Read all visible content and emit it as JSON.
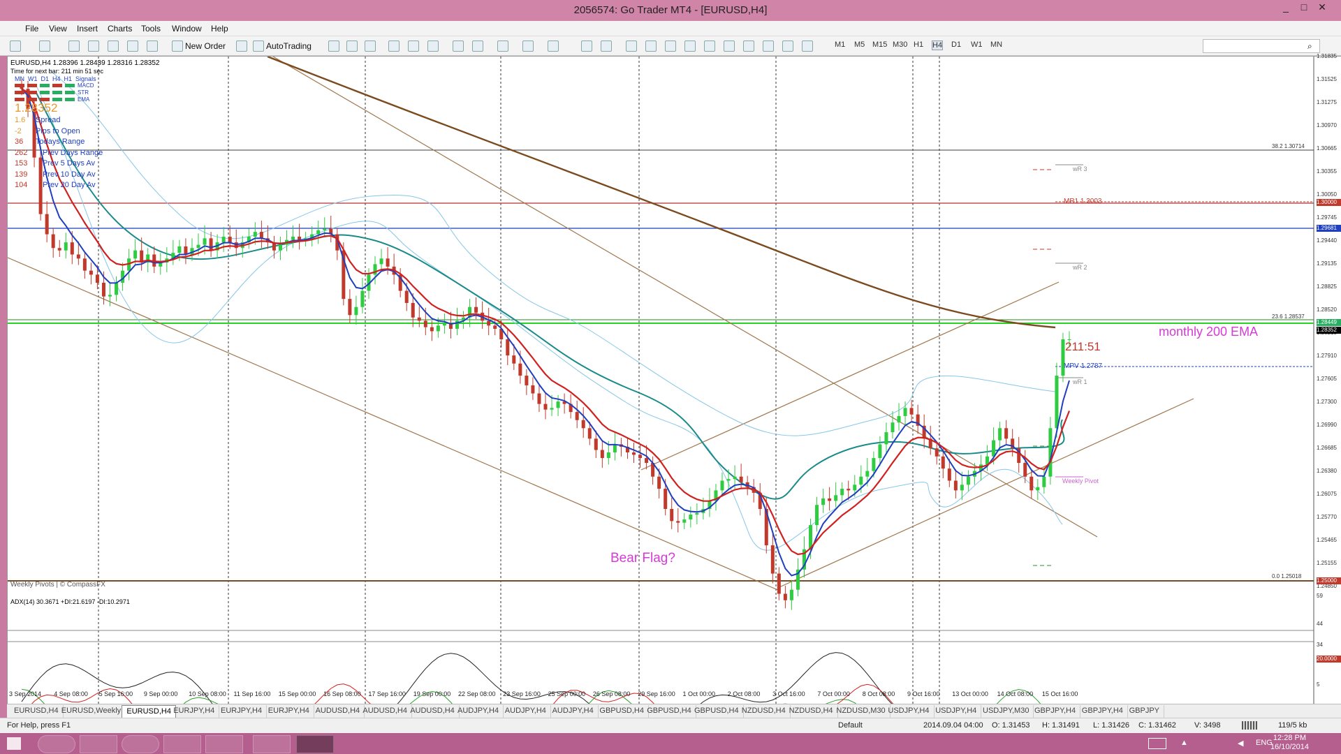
{
  "window": {
    "title": "2056574: Go Trader MT4 - [EURUSD,H4]",
    "minimize": "_",
    "maximize": "□",
    "close": "✕"
  },
  "menu": [
    "File",
    "View",
    "Insert",
    "Charts",
    "Tools",
    "Window",
    "Help"
  ],
  "toolbar": {
    "new_order": "New Order",
    "autotrading": "AutoTrading",
    "timeframes": [
      "M1",
      "M5",
      "M15",
      "M30",
      "H1",
      "H4",
      "D1",
      "W1",
      "MN"
    ],
    "active_timeframe": "H4"
  },
  "chart": {
    "header": "EURUSD,H4  1.28396 1.28439 1.28316 1.28352",
    "next_bar": "Time for next bar: 211 min 51 sec",
    "signal_cols": [
      "MN",
      "W1",
      "D1",
      "H4",
      "H1",
      "Signals"
    ],
    "signal_rows": [
      "MACD",
      "STR",
      "EMA"
    ],
    "price_big": "1.28352",
    "stats": [
      {
        "value": "1.6",
        "label": "Spread"
      },
      {
        "value": "-2",
        "label": "Pips to Open"
      },
      {
        "value": "36",
        "label": "Todays Range"
      },
      {
        "value": "262",
        "label": "Prev Days Range"
      },
      {
        "value": "153",
        "label": "Prev 5 Days Av"
      },
      {
        "value": "139",
        "label": "Prev 10 Day Av"
      },
      {
        "value": "104",
        "label": "Prev 20 Day Av"
      }
    ],
    "watermark": "Weekly Pivots | © CompassFX",
    "annotations": {
      "bear_flag": "Bear Flag?",
      "monthly_ema": "monthly 200 EMA",
      "countdown": "211:51",
      "mr1": "MR1  1.3003",
      "mpv": "MPV  1.2787",
      "wr3": "wR 3",
      "wr2": "wR 2",
      "wr1": "wR 1",
      "weekly_pivot": "Weekly Pivot",
      "fib_382": "38.2  1.30714",
      "fib_236": "23.6  1.28537",
      "fib_0": "0.0  1.25018"
    },
    "price_axis": [
      "1.31835",
      "1.31525",
      "1.31275",
      "1.30970",
      "1.30665",
      "1.30355",
      "1.30050",
      "1.29745",
      "1.29440",
      "1.29135",
      "1.28825",
      "1.28520",
      "1.28215",
      "1.27910",
      "1.27605",
      "1.27300",
      "1.26990",
      "1.26685",
      "1.26380",
      "1.26075",
      "1.25770",
      "1.25465",
      "1.25155",
      "1.24850"
    ],
    "price_tags": [
      {
        "text": "1.30000",
        "color": "#c0392b"
      },
      {
        "text": "1.29681",
        "color": "#1f3fbf"
      },
      {
        "text": "1.28449",
        "color": "#27ae60"
      },
      {
        "text": "1.28352",
        "color": "#000000"
      },
      {
        "text": "1.25000",
        "color": "#c0392b"
      }
    ],
    "adx_header": "ADX(14) 30.3671 +DI:21.6197 -DI:10.2971",
    "adx_axis": [
      "59",
      "44",
      "34",
      "20.0000",
      "5"
    ],
    "time_axis": [
      "3 Sep 2014",
      "4 Sep 08:00",
      "5 Sep 16:00",
      "9 Sep 00:00",
      "10 Sep 08:00",
      "11 Sep 16:00",
      "15 Sep 00:00",
      "16 Sep 08:00",
      "17 Sep 16:00",
      "19 Sep 00:00",
      "22 Sep 08:00",
      "23 Sep 16:00",
      "25 Sep 00:00",
      "26 Sep 08:00",
      "29 Sep 16:00",
      "1 Oct 00:00",
      "2 Oct 08:00",
      "3 Oct 16:00",
      "7 Oct 00:00",
      "8 Oct 08:00",
      "9 Oct 16:00",
      "13 Oct 00:00",
      "14 Oct 08:00",
      "15 Oct 16:00"
    ]
  },
  "tabs": [
    "EURUSD,H4",
    "EURUSD,Weekly",
    "EURUSD,H4",
    "EURJPY,H4",
    "EURJPY,H4",
    "EURJPY,H4",
    "AUDUSD,H4",
    "AUDUSD,H4",
    "AUDUSD,H4",
    "AUDJPY,H4",
    "AUDJPY,H4",
    "AUDJPY,H4",
    "GBPUSD,H4",
    "GBPUSD,H4",
    "GBPUSD,H4",
    "NZDUSD,H4",
    "NZDUSD,H4",
    "NZDUSD,M30",
    "USDJPY,H4",
    "USDJPY,H4",
    "USDJPY,M30",
    "GBPJPY,H4",
    "GBPJPY,H4",
    "GBPJPY"
  ],
  "active_tab": 2,
  "status": {
    "help": "For Help, press F1",
    "profile": "Default",
    "time": "2014.09.04 04:00",
    "open": "O: 1.31453",
    "high": "H: 1.31491",
    "close": "C: 1.31462",
    "low": "L: 1.31426",
    "volume": "V: 3498",
    "traffic": "119/5 kb"
  },
  "taskbar": {
    "lang": "ENG",
    "time": "12:28 PM",
    "date": "16/10/2014"
  },
  "colors": {
    "title_bg": "#cf84a8",
    "taskbar_bg": "#b45f8e",
    "ema_brown": "#7b4a1e",
    "blue_line": "#1f3fbf",
    "red_line": "#c0392b",
    "green_line": "#27ae60",
    "annotation_magenta": "#d63ad6"
  },
  "chart_data": {
    "type": "candlestick",
    "symbol": "EURUSD",
    "timeframe": "H4",
    "ylim": [
      1.2485,
      1.3185
    ],
    "closes": [
      1.3145,
      1.312,
      1.306,
      1.299,
      1.2965,
      1.2948,
      1.2945,
      1.2955,
      1.294,
      1.2935,
      1.292,
      1.2915,
      1.2905,
      1.2888,
      1.289,
      1.2905,
      1.292,
      1.2935,
      1.2945,
      1.293,
      1.294,
      1.2925,
      1.293,
      1.2935,
      1.2942,
      1.295,
      1.294,
      1.2948,
      1.2952,
      1.296,
      1.2945,
      1.2955,
      1.2962,
      1.2955,
      1.2948,
      1.2955,
      1.2962,
      1.2968,
      1.296,
      1.2955,
      1.2945,
      1.2952,
      1.2958,
      1.2962,
      1.2958,
      1.296,
      1.2965,
      1.297,
      1.2972,
      1.2965,
      1.2945,
      1.2885,
      1.2865,
      1.2875,
      1.2895,
      1.2915,
      1.2928,
      1.2935,
      1.2925,
      1.2915,
      1.2895,
      1.288,
      1.2862,
      1.2858,
      1.285,
      1.2845,
      1.2852,
      1.2855,
      1.2848,
      1.2858,
      1.2862,
      1.2875,
      1.2868,
      1.2858,
      1.2852,
      1.2848,
      1.2835,
      1.2815,
      1.2805,
      1.279,
      1.2778,
      1.2768,
      1.2755,
      1.2748,
      1.275,
      1.2758,
      1.2755,
      1.2745,
      1.2735,
      1.2725,
      1.2712,
      1.2698,
      1.2688,
      1.2695,
      1.2705,
      1.2702,
      1.2695,
      1.2692,
      1.2688,
      1.2682,
      1.2665,
      1.265,
      1.2625,
      1.261,
      1.2608,
      1.2612,
      1.2618,
      1.262,
      1.2625,
      1.2635,
      1.2648,
      1.266,
      1.2662,
      1.2665,
      1.2658,
      1.2652,
      1.2645,
      1.2625,
      1.258,
      1.2545,
      1.252,
      1.2512,
      1.2525,
      1.255,
      1.2575,
      1.2605,
      1.263,
      1.2638,
      1.2635,
      1.2642,
      1.265,
      1.2648,
      1.2655,
      1.2665,
      1.2672,
      1.2688,
      1.2705,
      1.272,
      1.2732,
      1.274,
      1.275,
      1.2742,
      1.2728,
      1.2712,
      1.27,
      1.269,
      1.2675,
      1.266,
      1.2648,
      1.2655,
      1.2665,
      1.2672,
      1.268,
      1.269,
      1.271,
      1.2725,
      1.2712,
      1.27,
      1.2682,
      1.2665,
      1.2648,
      1.2652,
      1.2665,
      1.2725,
      1.279,
      1.2835,
      1.2835
    ],
    "moving_averages": [
      "EMA 5 (blue)",
      "EMA 10 (red)",
      "EMA 20 (teal)",
      "monthly 200 EMA (brown)"
    ],
    "indicators": [
      "ADX(14)",
      "+DI",
      "-DI",
      "Bollinger Bands",
      "Weekly Pivots"
    ]
  }
}
